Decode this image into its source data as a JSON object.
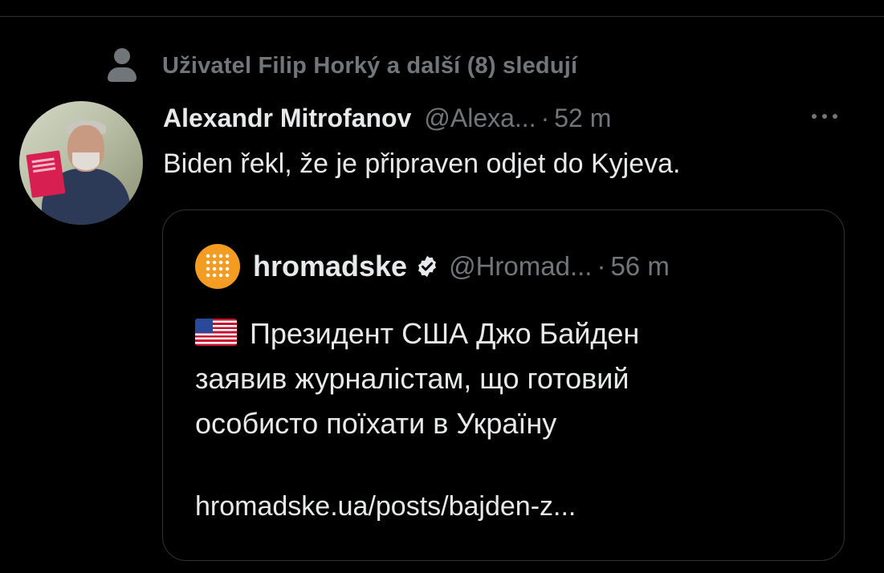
{
  "social_context": {
    "text": "Uživatel Filip Horký a další (8) sledují",
    "icon": "person-icon"
  },
  "tweet": {
    "author_name": "Alexandr Mitrofanov",
    "author_handle": "@Alexa...",
    "time": "52 m",
    "separator": "·",
    "text": "Biden řekl, že je připraven odjet do Kyjeva.",
    "more_icon": "more-icon"
  },
  "quote": {
    "author_name": "hromadske",
    "verified": true,
    "author_handle": "@Hromad...",
    "separator": "·",
    "time": "56 m",
    "flag": "us-flag-icon",
    "text_line1": "Президент США Джо Байден",
    "text_line2": "заявив журналістам, що готовий",
    "text_line3": "особисто поїхати в Україну",
    "link": "hromadske.ua/posts/bajden-z..."
  },
  "colors": {
    "background": "#000000",
    "text_primary": "#e7e9ea",
    "text_secondary": "#71767b",
    "border": "#2f3336",
    "hromadske_orange": "#f49b22"
  }
}
